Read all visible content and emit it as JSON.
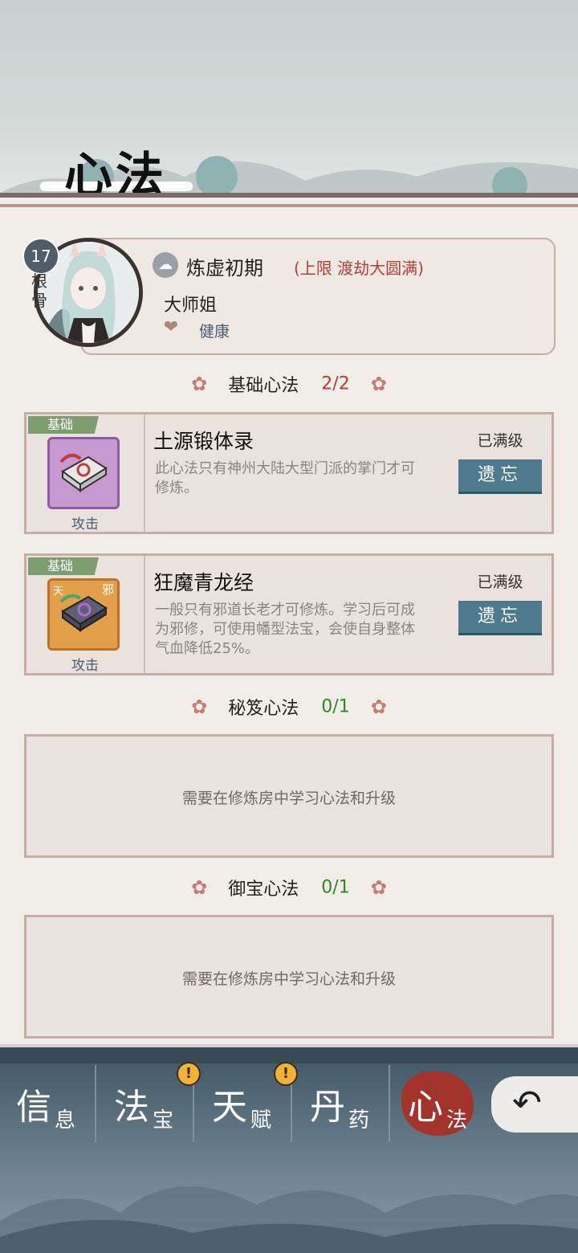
{
  "page": {
    "title": "心法"
  },
  "character": {
    "level": "17",
    "level_label": "根骨",
    "realm": "炼虚初期",
    "realm_limit": "(上限 渡劫大圆满)",
    "name": "大师姐",
    "status": "健康"
  },
  "sections": {
    "basic": {
      "name": "基础心法",
      "count": "2/2"
    },
    "secret": {
      "name": "秘笈心法",
      "count": "0/1",
      "empty_text": "需要在修炼房中学习心法和升级"
    },
    "treasure": {
      "name": "御宝心法",
      "count": "0/1",
      "empty_text": "需要在修炼房中学习心法和升级"
    }
  },
  "techniques": [
    {
      "tag": "基础",
      "name": "土源锻体录",
      "desc": "此心法只有神州大陆大型门派的掌门才可修炼。",
      "type": "攻击",
      "status": "已满级",
      "button": "遗忘"
    },
    {
      "tag": "基础",
      "name": "狂魔青龙经",
      "desc": "一般只有邪道长老才可修炼。学习后可成为邪修，可使用幡型法宝，会使自身整体气血降低25%。",
      "type": "攻击",
      "status": "已满级",
      "button": "遗忘",
      "icon_chars": [
        "天",
        "邪"
      ]
    }
  ],
  "nav": [
    {
      "big": "信",
      "small": "息"
    },
    {
      "big": "法",
      "small": "宝"
    },
    {
      "big": "天",
      "small": "赋"
    },
    {
      "big": "丹",
      "small": "药"
    },
    {
      "big": "心",
      "small": "法"
    }
  ],
  "alert_glyph": "!",
  "colors": {
    "accent_red": "#b24033",
    "button_teal": "#4d7a8c",
    "tag_green": "#7d9f70",
    "count_green": "#2e8a1f"
  }
}
